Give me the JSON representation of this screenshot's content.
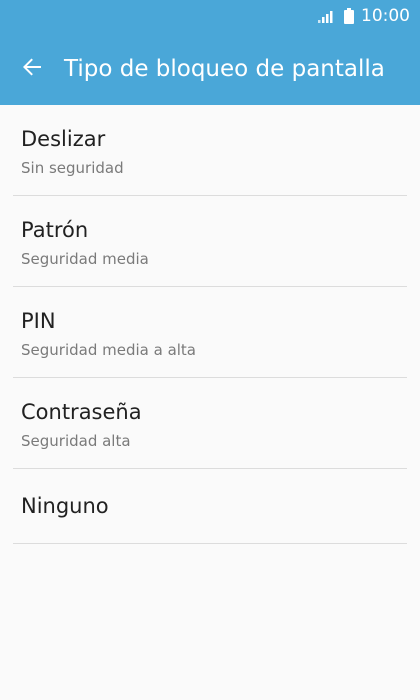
{
  "status_bar": {
    "time": "10:00",
    "signal_icon": "signal-icon",
    "battery_icon": "battery-icon"
  },
  "app_bar": {
    "back_icon": "back-arrow-icon",
    "title": "Tipo de bloqueo de pantalla",
    "background_color": "#4aa7d8"
  },
  "options": [
    {
      "label": "Deslizar",
      "description": "Sin seguridad"
    },
    {
      "label": "Patrón",
      "description": "Seguridad media"
    },
    {
      "label": "PIN",
      "description": "Seguridad media a alta"
    },
    {
      "label": "Contraseña",
      "description": "Seguridad alta"
    },
    {
      "label": "Ninguno"
    }
  ]
}
